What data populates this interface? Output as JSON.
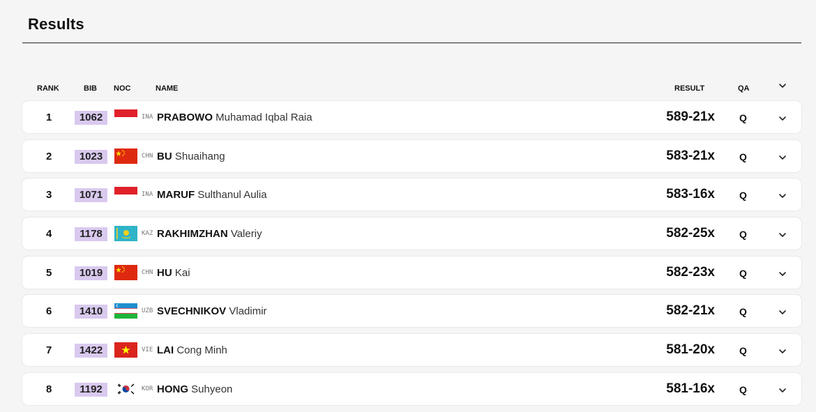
{
  "page": {
    "title": "Results"
  },
  "columns": {
    "rank": "RANK",
    "bib": "BIB",
    "noc": "NOC",
    "name": "NAME",
    "result": "RESULT",
    "qa": "QA"
  },
  "colors": {
    "bib_bg": "#d9c9ee",
    "row_bg": "#ffffff",
    "page_bg": "#f5f5f5"
  },
  "rows": [
    {
      "rank": "1",
      "bib": "1062",
      "noc": "INA",
      "flag": "indonesia-flag-icon",
      "last": "PRABOWO",
      "first": "Muhamad Iqbal Raia",
      "result": "589-21x",
      "qa": "Q"
    },
    {
      "rank": "2",
      "bib": "1023",
      "noc": "CHN",
      "flag": "china-flag-icon",
      "last": "BU",
      "first": "Shuaihang",
      "result": "583-21x",
      "qa": "Q"
    },
    {
      "rank": "3",
      "bib": "1071",
      "noc": "INA",
      "flag": "indonesia-flag-icon",
      "last": "MARUF",
      "first": "Sulthanul Aulia",
      "result": "583-16x",
      "qa": "Q"
    },
    {
      "rank": "4",
      "bib": "1178",
      "noc": "KAZ",
      "flag": "kazakhstan-flag-icon",
      "last": "RAKHIMZHAN",
      "first": "Valeriy",
      "result": "582-25x",
      "qa": "Q"
    },
    {
      "rank": "5",
      "bib": "1019",
      "noc": "CHN",
      "flag": "china-flag-icon",
      "last": "HU",
      "first": "Kai",
      "result": "582-23x",
      "qa": "Q"
    },
    {
      "rank": "6",
      "bib": "1410",
      "noc": "UZB",
      "flag": "uzbekistan-flag-icon",
      "last": "SVECHNIKOV",
      "first": "Vladimir",
      "result": "582-21x",
      "qa": "Q"
    },
    {
      "rank": "7",
      "bib": "1422",
      "noc": "VIE",
      "flag": "vietnam-flag-icon",
      "last": "LAI",
      "first": "Cong Minh",
      "result": "581-20x",
      "qa": "Q"
    },
    {
      "rank": "8",
      "bib": "1192",
      "noc": "KOR",
      "flag": "korea-flag-icon",
      "last": "HONG",
      "first": "Suhyeon",
      "result": "581-16x",
      "qa": "Q"
    }
  ]
}
